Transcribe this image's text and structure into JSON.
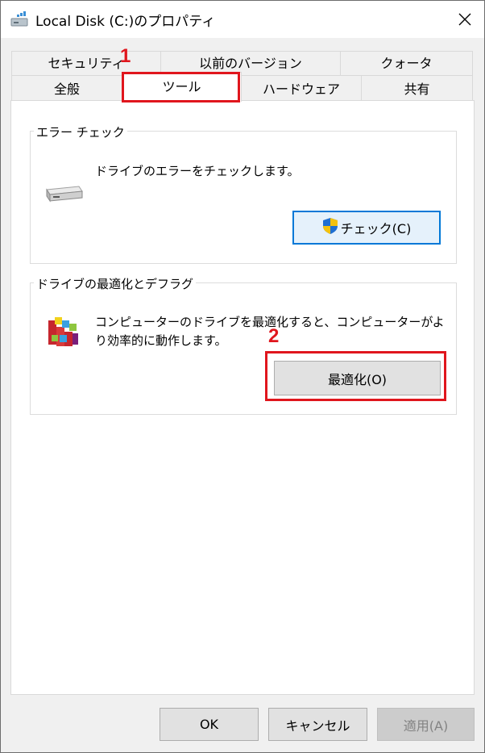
{
  "window": {
    "title": "Local Disk (C:)のプロパティ",
    "icons": {
      "drive": "drive-icon",
      "close": "close-icon"
    }
  },
  "tabs": {
    "row_top": [
      {
        "label": "セキュリティ"
      },
      {
        "label": "以前のバージョン"
      },
      {
        "label": "クォータ"
      }
    ],
    "row_bottom": [
      {
        "label": "全般"
      },
      {
        "label": "ツール",
        "selected": true
      },
      {
        "label": "ハードウェア"
      },
      {
        "label": "共有"
      }
    ]
  },
  "error_check": {
    "group_title": "エラー チェック",
    "description": "ドライブのエラーをチェックします。",
    "button_label": "チェック(C)",
    "icons": {
      "drive": "hard-drive-icon",
      "shield": "uac-shield-icon"
    }
  },
  "optimize": {
    "group_title": "ドライブの最適化とデフラグ",
    "description_line1": "コンピューターのドライブを最適化すると、コンピューターがよ",
    "description_line2": "り効率的に動作します。",
    "button_label": "最適化(O)",
    "icons": {
      "defrag": "defrag-blocks-icon"
    }
  },
  "footer": {
    "ok_label": "OK",
    "cancel_label": "キャンセル",
    "apply_label": "適用(A)"
  },
  "annotations": {
    "step1": "1",
    "step2": "2",
    "color": "#e0161d"
  },
  "colors": {
    "focus_border": "#0078d7",
    "window_bg": "#f0f0f0",
    "button_bg": "#e1e1e1"
  }
}
